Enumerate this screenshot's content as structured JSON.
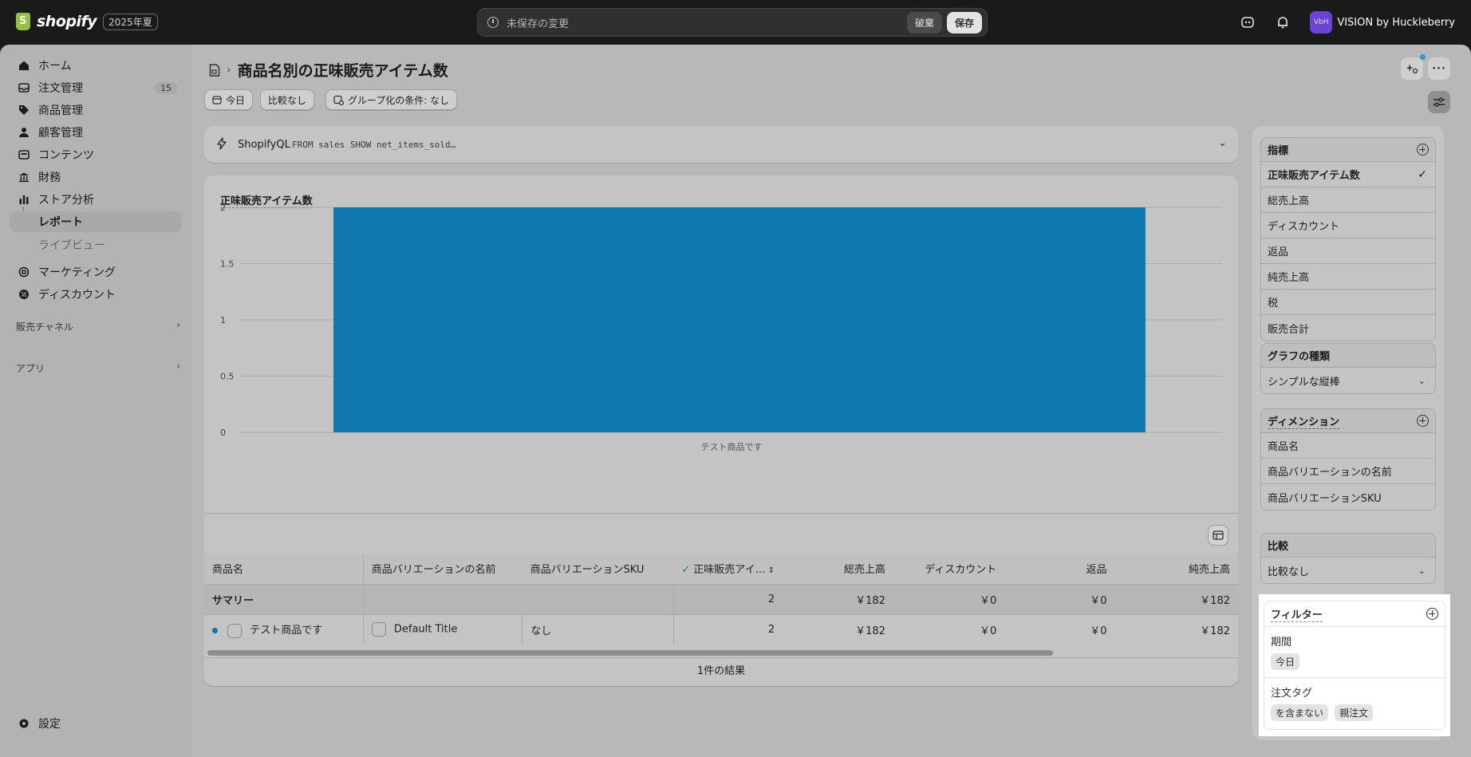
{
  "topbar": {
    "brand": "shopify",
    "badge": "2025年夏",
    "unsaved_text": "未保存の変更",
    "discard_label": "破棄",
    "save_label": "保存",
    "avatar_initials": "VbH",
    "store_name": "VISION by Huckleberry"
  },
  "sidebar": {
    "items": [
      {
        "label": "ホーム",
        "icon": "home-icon"
      },
      {
        "label": "注文管理",
        "icon": "inbox-icon",
        "badge": "15"
      },
      {
        "label": "商品管理",
        "icon": "tag-icon"
      },
      {
        "label": "顧客管理",
        "icon": "person-icon"
      },
      {
        "label": "コンテンツ",
        "icon": "content-icon"
      },
      {
        "label": "財務",
        "icon": "bank-icon"
      },
      {
        "label": "ストア分析",
        "icon": "chart-icon"
      }
    ],
    "sub_items": [
      {
        "label": "レポート"
      },
      {
        "label": "ライブビュー"
      }
    ],
    "items2": [
      {
        "label": "マーケティング",
        "icon": "target-icon"
      },
      {
        "label": "ディスカウント",
        "icon": "discount-icon"
      }
    ],
    "sales_channels": "販売チャネル",
    "apps": "アプリ",
    "settings": "設定"
  },
  "page": {
    "title": "商品名別の正味販売アイテム数",
    "filters": {
      "date": "今日",
      "compare": "比較なし",
      "group_by": "グループ化の条件: なし"
    }
  },
  "shopifyql": {
    "label": "ShopifyQL",
    "query": "FROM sales SHOW net_items_sold…"
  },
  "chart_data": {
    "type": "bar",
    "title": "正味販売アイテム数",
    "categories": [
      "テスト商品です"
    ],
    "values": [
      2
    ],
    "ylim": [
      0,
      2
    ],
    "yticks": [
      "2",
      "1.5",
      "1",
      "0.5",
      "0"
    ],
    "color": "#0e77ab",
    "grid": true
  },
  "table": {
    "headers": [
      "商品名",
      "商品バリエーションの名前",
      "商品バリエーションSKU",
      "正味販売アイ…",
      "総売上高",
      "ディスカウント",
      "返品",
      "純売上高"
    ],
    "summary": [
      "サマリー",
      "",
      "",
      "2",
      "￥182",
      "￥0",
      "￥0",
      "￥182"
    ],
    "rows": [
      [
        "テスト商品です",
        "Default Title",
        "なし",
        "2",
        "￥182",
        "￥0",
        "￥0",
        "￥182"
      ]
    ],
    "footer": "1件の結果"
  },
  "panel": {
    "metrics": {
      "title": "指標",
      "items": [
        "正味販売アイテム数",
        "総売上高",
        "ディスカウント",
        "返品",
        "純売上高",
        "税",
        "販売合計"
      ]
    },
    "chart_type": {
      "title": "グラフの種類",
      "value": "シンプルな縦棒"
    },
    "dimensions": {
      "title": "ディメンション",
      "items": [
        "商品名",
        "商品バリエーションの名前",
        "商品バリエーションSKU"
      ]
    },
    "comparison": {
      "title": "比較",
      "value": "比較なし"
    },
    "filters": {
      "title": "フィルター",
      "period_label": "期間",
      "period_value": "今日",
      "order_tag_label": "注文タグ",
      "order_tag_values": [
        "を含まない",
        "親注文"
      ]
    }
  }
}
